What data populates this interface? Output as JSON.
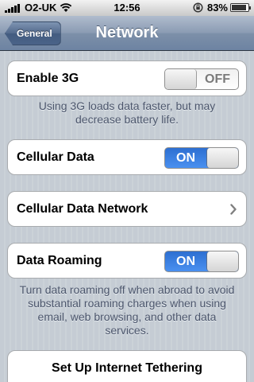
{
  "status_bar": {
    "carrier": "O2-UK",
    "time": "12:56",
    "battery_percent": "83%",
    "icons": [
      "signal-icon",
      "wifi-icon",
      "rotation-lock-icon",
      "battery-icon"
    ]
  },
  "nav_bar": {
    "back_label": "General",
    "title": "Network"
  },
  "settings": {
    "enable_3g": {
      "label": "Enable 3G",
      "state": "OFF",
      "on": false
    },
    "enable_3g_note": "Using 3G loads data faster, but may decrease battery life.",
    "cellular_data": {
      "label": "Cellular Data",
      "state": "ON",
      "on": true
    },
    "cellular_data_network": {
      "label": "Cellular Data Network"
    },
    "data_roaming": {
      "label": "Data Roaming",
      "state": "ON",
      "on": true
    },
    "data_roaming_note": "Turn data roaming off when abroad to avoid substantial roaming charges when using email, web browsing, and other data services.",
    "tethering": {
      "label": "Set Up Internet Tethering"
    }
  },
  "colors": {
    "toggle_on": "#3d7fe0",
    "nav_bar": "#8a9bb3",
    "background": "#c5ccd4",
    "footnote_text": "#4c566c"
  }
}
